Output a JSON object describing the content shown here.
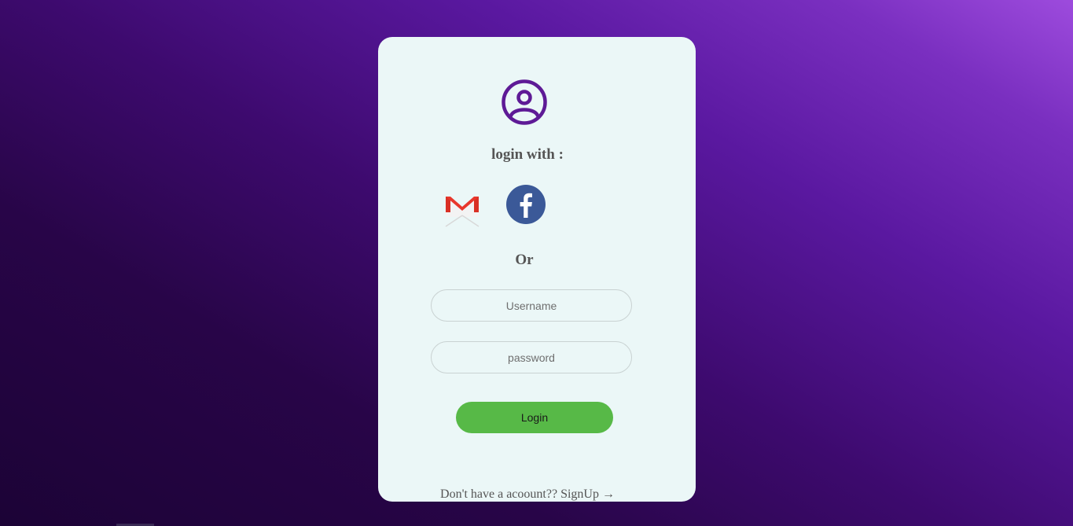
{
  "login_card": {
    "avatar_icon": "user-circle-icon",
    "login_with_label": "login with :",
    "social": {
      "gmail_icon": "gmail-icon",
      "facebook_icon": "facebook-icon"
    },
    "or_label": "Or",
    "username_placeholder": "Username",
    "password_placeholder": "password",
    "login_button_label": "Login",
    "signup_prompt": "Don't have a acoount?? ",
    "signup_link_label": "SignUp →"
  },
  "colors": {
    "accent_purple": "#5e1a96",
    "login_button": "#57b947",
    "card_background": "#ebf7f7",
    "facebook_blue": "#3b5998",
    "gmail_red": "#d93025"
  }
}
